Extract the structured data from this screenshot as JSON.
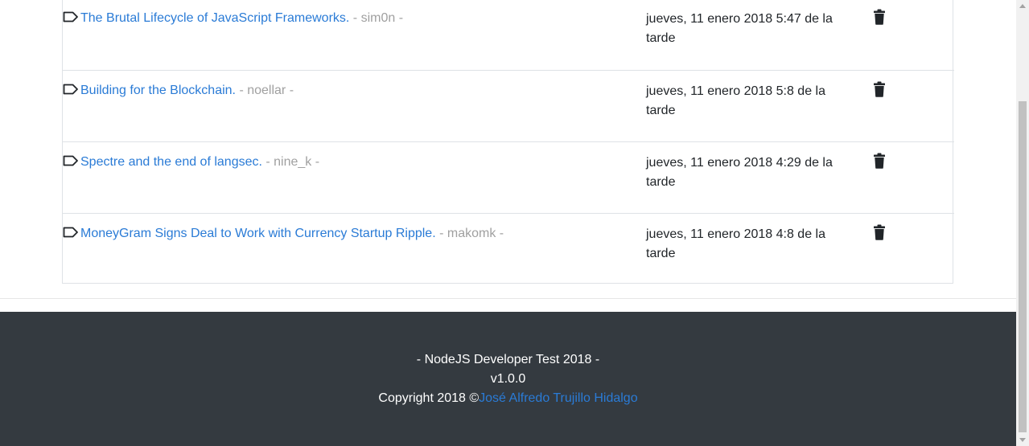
{
  "articles": [
    {
      "title": "The Brutal Lifecycle of JavaScript Frameworks.",
      "author": " - sim0n -",
      "date": "jueves, 11 enero 2018 5:47 de la tarde",
      "tag_icon": "tag-outline-icon",
      "delete_icon": "trash-icon"
    },
    {
      "title": "Building for the Blockchain.",
      "author": " - noellar -",
      "date": "jueves, 11 enero 2018 5:8 de la tarde",
      "tag_icon": "tag-outline-icon",
      "delete_icon": "trash-icon"
    },
    {
      "title": "Spectre and the end of langsec.",
      "author": " - nine_k -",
      "date": "jueves, 11 enero 2018 4:29 de la tarde",
      "tag_icon": "tag-outline-icon",
      "delete_icon": "trash-icon"
    },
    {
      "title": "MoneyGram Signs Deal to Work with Currency Startup Ripple.",
      "author": " - makomk -",
      "date": "jueves, 11 enero 2018 4:8 de la tarde",
      "tag_icon": "tag-outline-icon",
      "delete_icon": "trash-icon"
    }
  ],
  "footer": {
    "line1": "- NodeJS Developer Test 2018 -",
    "line2": "v1.0.0",
    "copyright_prefix": "Copyright 2018 ©",
    "author_link": "José Alfredo Trujillo Hidalgo"
  },
  "colors": {
    "link": "#2a7bd6",
    "muted": "#a0a0a0",
    "footer_bg": "#343a40",
    "border": "#dee2e6"
  }
}
